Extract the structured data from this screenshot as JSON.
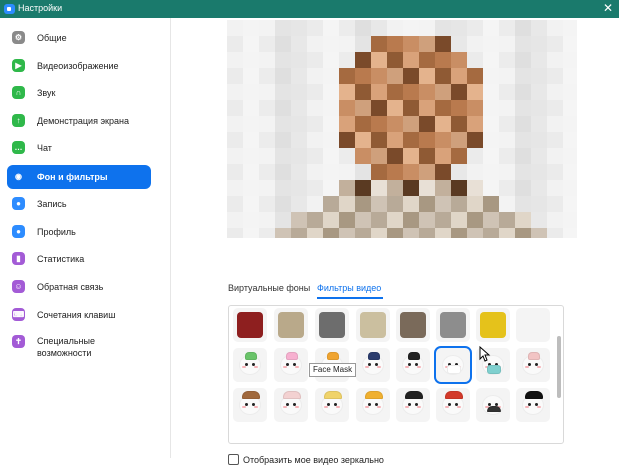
{
  "window": {
    "title": "Настройки",
    "close_glyph": "✕"
  },
  "sidebar": {
    "items": [
      {
        "label": "Общие",
        "icon": "gear-icon",
        "color": "#8a8a8a",
        "glyph": "⚙"
      },
      {
        "label": "Видеоизображение",
        "icon": "video-camera-icon",
        "color": "#2fb84a",
        "glyph": "▶"
      },
      {
        "label": "Звук",
        "icon": "headphones-icon",
        "color": "#2fb84a",
        "glyph": "∩"
      },
      {
        "label": "Демонстрация экрана",
        "icon": "screen-share-icon",
        "color": "#2fb84a",
        "glyph": "↑"
      },
      {
        "label": "Чат",
        "icon": "chat-bubble-icon",
        "color": "#2fb84a",
        "glyph": "…"
      },
      {
        "label": "Фон и фильтры",
        "icon": "background-person-icon",
        "color": "#ffffff",
        "glyph": "◉",
        "active": true
      },
      {
        "label": "Запись",
        "icon": "record-icon",
        "color": "#2d8cff",
        "glyph": "●"
      },
      {
        "label": "Профиль",
        "icon": "profile-icon",
        "color": "#2d8cff",
        "glyph": "●"
      },
      {
        "label": "Статистика",
        "icon": "statistics-icon",
        "color": "#a35bd6",
        "glyph": "▮"
      },
      {
        "label": "Обратная связь",
        "icon": "feedback-icon",
        "color": "#a35bd6",
        "glyph": "☺"
      },
      {
        "label": "Сочетания клавиш",
        "icon": "keyboard-icon",
        "color": "#a35bd6",
        "glyph": "⌨"
      },
      {
        "label": "Специальные возможности",
        "icon": "accessibility-icon",
        "color": "#a35bd6",
        "glyph": "✝"
      }
    ]
  },
  "tabs": [
    {
      "label": "Виртуальные фоны",
      "active": false
    },
    {
      "label": "Фильтры видео",
      "active": true
    }
  ],
  "filters": {
    "row1": [
      {
        "name": "theater-curtain-filter",
        "color": "#8e1f1f"
      },
      {
        "name": "retro-tv-filter",
        "color": "#b9a98a"
      },
      {
        "name": "camera-frame-filter",
        "color": "#6d6d6d"
      },
      {
        "name": "vintage-frame-filter",
        "color": "#cbbf9f"
      },
      {
        "name": "old-tv-filter",
        "color": "#7a6a5a"
      },
      {
        "name": "gallery-frame-filter",
        "color": "#8d8d8d"
      },
      {
        "name": "sunflower-frame-filter",
        "color": "#e5c21b"
      },
      {
        "name": "pixel-sunglasses-filter",
        "color": "#f4f4f4"
      }
    ],
    "row2": [
      {
        "name": "sprout-face-filter",
        "accent": "#6ac46a"
      },
      {
        "name": "rainbow-face-filter",
        "accent": "#f7b0d0"
      },
      {
        "name": "party-hat-face-filter",
        "accent": "#f0a430"
      },
      {
        "name": "cap-face-filter",
        "accent": "#2b3c6d"
      },
      {
        "name": "plain-face-filter",
        "accent": "#222222"
      },
      {
        "name": "white-mask-face-filter",
        "accent": "#ffffff",
        "selected": true
      },
      {
        "name": "face-mask-filter",
        "accent": "#7fd0cf"
      },
      {
        "name": "mouse-ears-face-filter",
        "accent": "#f2c4c4"
      }
    ],
    "row3": [
      {
        "name": "reindeer-face-filter",
        "accent": "#a0683c"
      },
      {
        "name": "bunny-face-filter",
        "accent": "#f3d1d1"
      },
      {
        "name": "unicorn-face-filter",
        "accent": "#f0d36a"
      },
      {
        "name": "crown-face-filter",
        "accent": "#f0b030"
      },
      {
        "name": "graduation-cap-face-filter",
        "accent": "#222222"
      },
      {
        "name": "beret-face-filter",
        "accent": "#d33a2a"
      },
      {
        "name": "mustache-face-filter",
        "accent": "#333333"
      },
      {
        "name": "detective-face-filter",
        "accent": "#111111"
      }
    ]
  },
  "tooltip": "Face Mask",
  "mirror": {
    "label": "Отобразить мое видео зеркально",
    "checked": false
  }
}
